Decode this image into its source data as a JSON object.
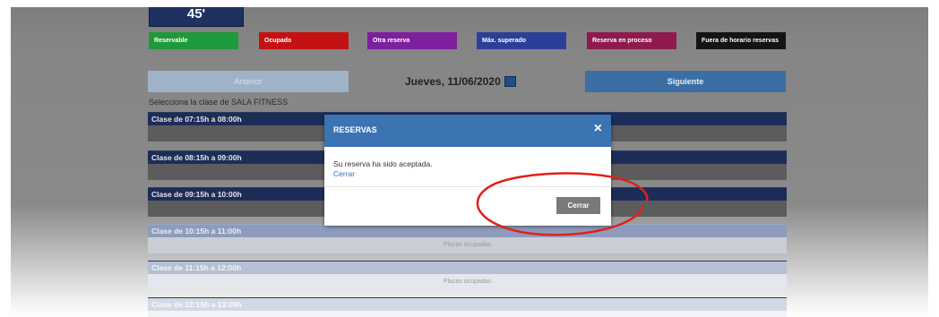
{
  "header": {
    "time_remaining": "45'"
  },
  "legend": [
    {
      "label": "Reservable",
      "color": "#1e9a3a"
    },
    {
      "label": "Ocupado",
      "color": "#c41212"
    },
    {
      "label": "Otra reserva",
      "color": "#7e1f9e"
    },
    {
      "label": "Máx. superado",
      "color": "#2b3f99"
    },
    {
      "label": "Reserva en proceso",
      "color": "#8f1a4e"
    },
    {
      "label": "Fuera de horario reservas",
      "color": "#141414"
    }
  ],
  "navigation": {
    "prev_label": "Anterior",
    "date": "Jueves, 11/06/2020",
    "next_label": "Siguiente"
  },
  "subtitle": "Selecciona la clase de SALA FITNESS",
  "slots": [
    {
      "label": "Clase de 07:15h a 08:00h",
      "status": ""
    },
    {
      "label": "Clase de 08:15h a 09:00h",
      "status": ""
    },
    {
      "label": "Clase de 09:15h a 10:00h",
      "status": ""
    },
    {
      "label": "Clase de 10:15h a 11:00h",
      "status": "Plazas ocupadas"
    },
    {
      "label": "Clase de 11:15h a 12:00h",
      "status": "Plazas ocupadas"
    },
    {
      "label": "Clase de 12:15h a 13:00h",
      "status": ""
    }
  ],
  "modal": {
    "title": "RESERVAS",
    "close_icon": "×",
    "message": "Su reserva ha sido aceptada.",
    "link": "Cerrar",
    "button": "Cerrar"
  },
  "annotation_color": "#e0201b"
}
